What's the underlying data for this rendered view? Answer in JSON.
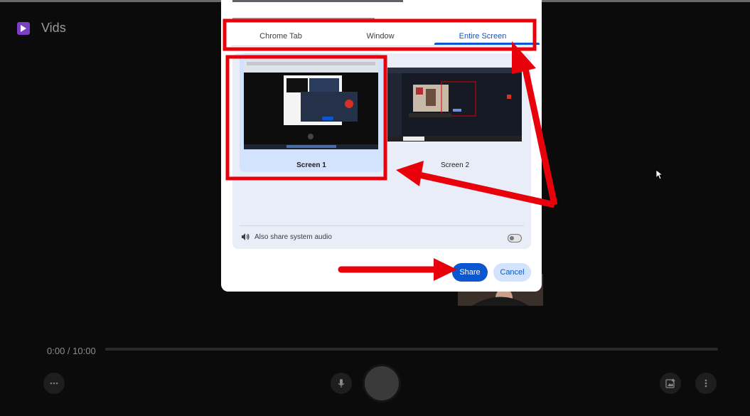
{
  "app": {
    "title": "Vids",
    "logo_icon": "play-icon"
  },
  "dialog": {
    "tabs": [
      {
        "label": "Chrome Tab",
        "active": false
      },
      {
        "label": "Window",
        "active": false
      },
      {
        "label": "Entire Screen",
        "active": true
      }
    ],
    "screens": [
      {
        "label": "Screen 1",
        "selected": true
      },
      {
        "label": "Screen 2",
        "selected": false
      }
    ],
    "audio_label": "Also share system audio",
    "audio_enabled": false,
    "share_label": "Share",
    "cancel_label": "Cancel"
  },
  "player": {
    "time": "0:00 / 10:00"
  },
  "colors": {
    "accent": "#0b57d0",
    "selected_tile": "#d3e3fd",
    "annotation": "#e8000b",
    "logo": "#7a3fc4"
  }
}
